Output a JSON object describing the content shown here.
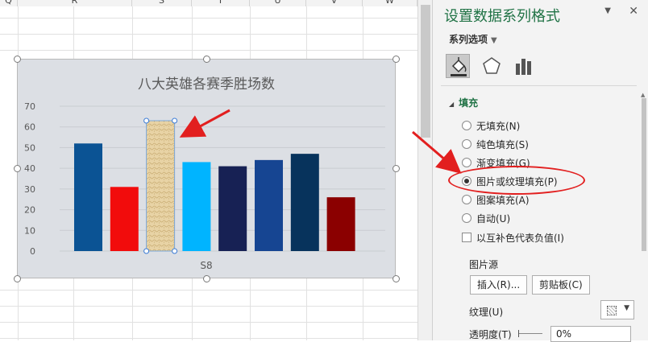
{
  "sheet": {
    "columns": [
      "Q",
      "R",
      "S",
      "T",
      "U",
      "V",
      "W"
    ]
  },
  "chart": {
    "title": "八大英雄各赛季胜场数",
    "category_label": "S8"
  },
  "chart_data": {
    "type": "bar",
    "title": "八大英雄各赛季胜场数",
    "categories": [
      "S8"
    ],
    "series": [
      {
        "values": [
          52
        ],
        "color": "#0b5394"
      },
      {
        "values": [
          31
        ],
        "color": "#f20c0c"
      },
      {
        "values": [
          63
        ],
        "color": "#e8d3a5"
      },
      {
        "values": [
          43
        ],
        "color": "#00b4ff"
      },
      {
        "values": [
          41
        ],
        "color": "#172154"
      },
      {
        "values": [
          44
        ],
        "color": "#164592"
      },
      {
        "values": [
          47
        ],
        "color": "#07335c"
      },
      {
        "values": [
          26
        ],
        "color": "#8b0000"
      }
    ],
    "yticks": [
      "0",
      "10",
      "20",
      "30",
      "40",
      "50",
      "60",
      "70"
    ],
    "ylim": [
      0,
      70
    ],
    "grid": true
  },
  "pane": {
    "title": "设置数据系列格式",
    "series_options": "系列选项",
    "fill_section": "填充",
    "radios": [
      {
        "label": "无填充(N)",
        "checked": false
      },
      {
        "label": "纯色填充(S)",
        "checked": false
      },
      {
        "label": "渐变填充(G)",
        "checked": false
      },
      {
        "label": "图片或纹理填充(P)",
        "checked": true
      },
      {
        "label": "图案填充(A)",
        "checked": false
      },
      {
        "label": "自动(U)",
        "checked": false
      }
    ],
    "invert_label": "以互补色代表负值(I)",
    "picture_source_label": "图片源",
    "insert_button": "插入(R)...",
    "clipboard_button": "剪贴板(C)",
    "texture_label": "纹理(U)",
    "transparency_label": "透明度(T)",
    "transparency_value": "0%"
  },
  "colors": {
    "accent": "#217346",
    "annotation": "#e21f1f"
  }
}
